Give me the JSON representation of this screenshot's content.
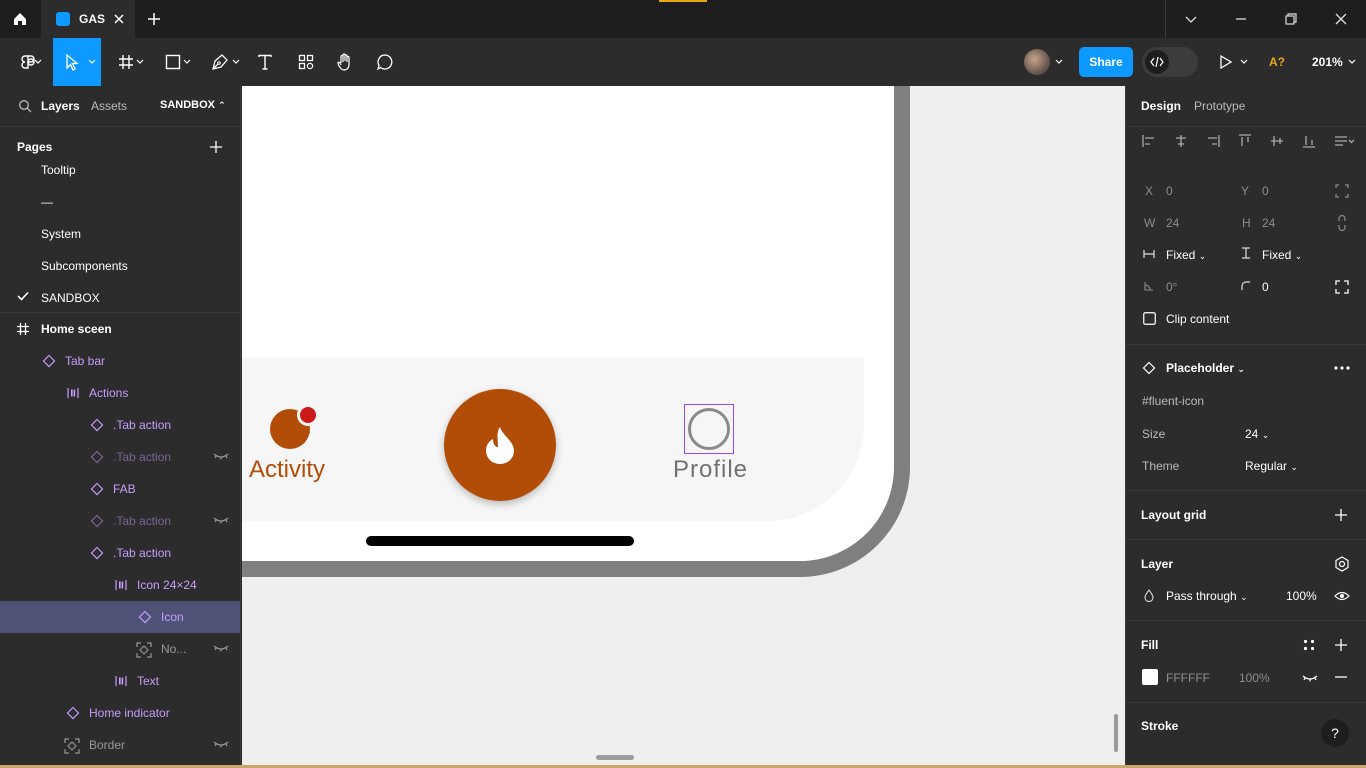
{
  "titlebar": {
    "tab_title": "GAS",
    "icons": [
      "home-icon",
      "figma-file-icon",
      "close-icon",
      "plus-icon",
      "chevron-down-icon",
      "minimize-icon",
      "restore-icon",
      "close-window-icon"
    ]
  },
  "toolbar": {
    "share_label": "Share",
    "a11y_label": "A?",
    "zoom_label": "201%",
    "tools": [
      "main-menu",
      "move",
      "frame",
      "shape",
      "pen",
      "text",
      "resources",
      "hand",
      "comment"
    ]
  },
  "left_panel": {
    "tabs": {
      "layers": "Layers",
      "assets": "Assets",
      "page_switcher": "SANDBOX"
    },
    "pages_title": "Pages",
    "pages": [
      "Tooltip",
      "—",
      "System",
      "Subcomponents",
      "SANDBOX"
    ],
    "current_page": "SANDBOX",
    "layers": [
      {
        "label": "Home sceen",
        "icon": "frame-icon"
      },
      {
        "label": "Tab bar",
        "icon": "instance-icon"
      },
      {
        "label": "Actions",
        "icon": "auto-layout-icon"
      },
      {
        "label": ".Tab action",
        "icon": "instance-icon"
      },
      {
        "label": ".Tab action",
        "icon": "instance-icon",
        "hidden": true
      },
      {
        "label": "FAB",
        "icon": "instance-icon"
      },
      {
        "label": ".Tab action",
        "icon": "instance-icon",
        "hidden": true
      },
      {
        "label": ".Tab action",
        "icon": "instance-icon"
      },
      {
        "label": "Icon 24×24",
        "icon": "auto-layout-icon"
      },
      {
        "label": "Icon",
        "icon": "instance-icon",
        "selected": true
      },
      {
        "label": "No...",
        "icon": "slot-icon",
        "hidden": true
      },
      {
        "label": "Text",
        "icon": "auto-layout-icon"
      },
      {
        "label": "Home indicator",
        "icon": "instance-icon"
      },
      {
        "label": "Border",
        "icon": "slot-icon",
        "hidden": true
      }
    ]
  },
  "canvas": {
    "activity_label": "Activity",
    "profile_label": "Profile",
    "brand_color": "#b14d06",
    "badge_color": "#cc1a1a",
    "selection_color": "#9747ff"
  },
  "right_panel": {
    "tabs": {
      "design": "Design",
      "prototype": "Prototype"
    },
    "position": {
      "x_label": "X",
      "x": "0",
      "y_label": "Y",
      "y": "0"
    },
    "size": {
      "w_label": "W",
      "w": "24",
      "h_label": "H",
      "h": "24"
    },
    "resizing": {
      "h": "Fixed",
      "v": "Fixed"
    },
    "rotation": "0°",
    "radius": "0",
    "clip_content": "Clip content",
    "component": {
      "name": "Placeholder",
      "property_name": "#fluent-icon",
      "size_label": "Size",
      "size_value": "24",
      "theme_label": "Theme",
      "theme_value": "Regular"
    },
    "layout_grid": "Layout grid",
    "layer": {
      "title": "Layer",
      "blend": "Pass through",
      "opacity": "100%"
    },
    "fill": {
      "title": "Fill",
      "hex": "FFFFFF",
      "opacity": "100%"
    },
    "stroke": {
      "title": "Stroke"
    },
    "help": "?"
  }
}
